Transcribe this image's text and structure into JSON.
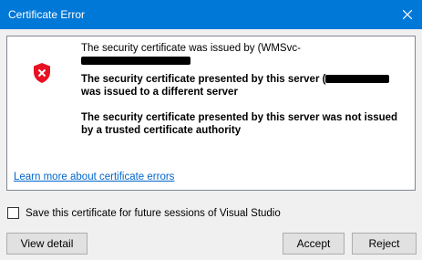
{
  "window": {
    "title": "Certificate Error",
    "close_glyph": "close-icon"
  },
  "messages": {
    "line1": "The security certificate was issued by (WMSvc-",
    "line2a": "The security certificate presented by this server (",
    "line2b": "was issued to a different server",
    "line3": "The security certificate presented by this server was not issued by a trusted certificate authority",
    "link": "Learn more about certificate errors"
  },
  "options": {
    "save_label": "Save this certificate for future sessions of Visual Studio",
    "save_checked": false
  },
  "buttons": {
    "view_detail": "View detail",
    "accept": "Accept",
    "reject": "Reject"
  },
  "colors": {
    "titlebar": "#0078d7",
    "shield": "#e81123",
    "link": "#0066cc"
  },
  "icons": {
    "status": "shield-error-icon"
  }
}
